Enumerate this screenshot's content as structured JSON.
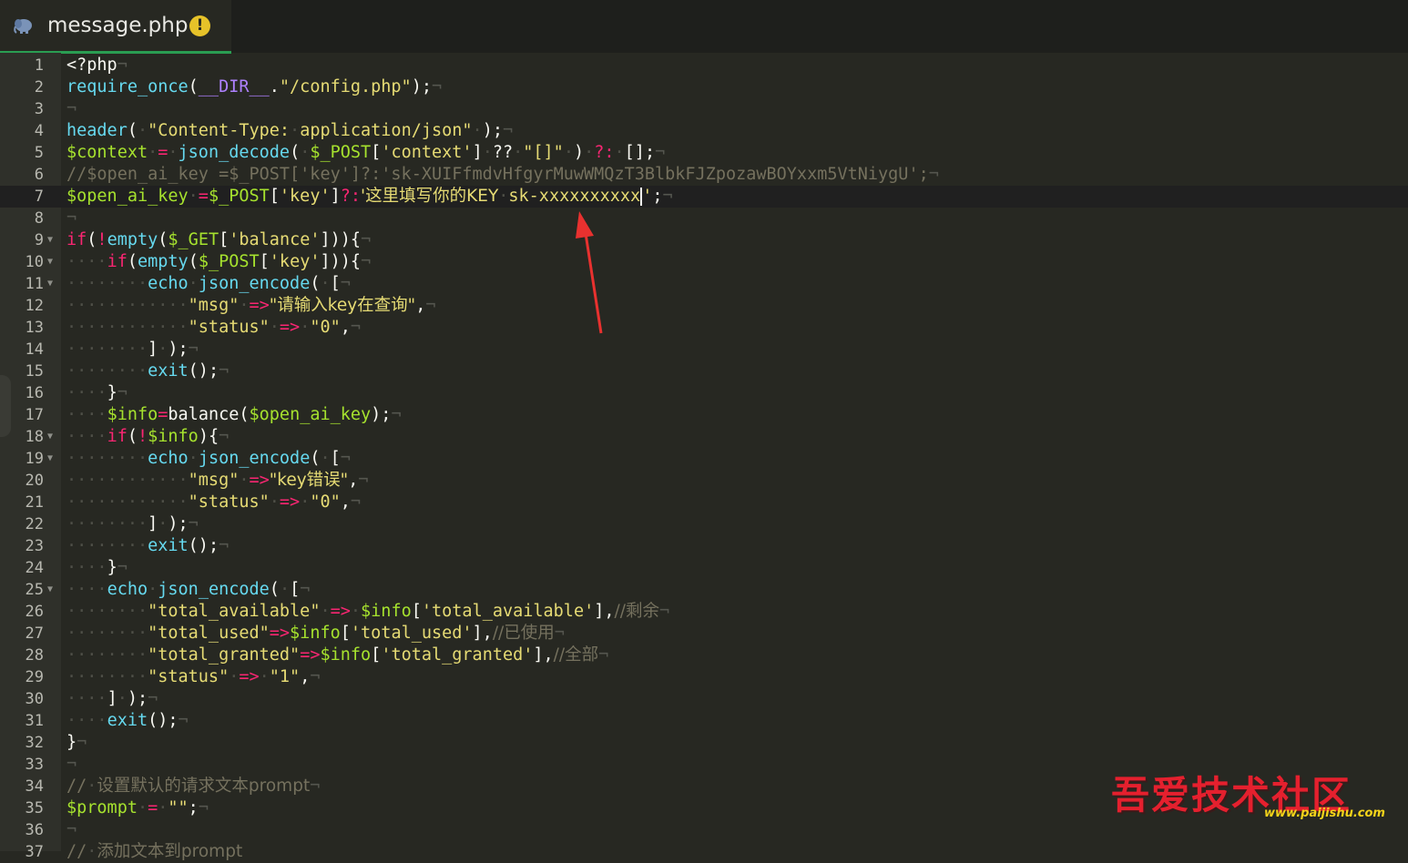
{
  "tab": {
    "filename": "message.php",
    "warning_glyph": "!",
    "file_icon": "php-elephant-icon",
    "active_color": "#2a9d52"
  },
  "active_line": 7,
  "lines": [
    {
      "n": "1",
      "fold": false,
      "tokens": [
        [
          "w",
          "<?php"
        ],
        [
          "e",
          "¬"
        ]
      ]
    },
    {
      "n": "2",
      "fold": false,
      "tokens": [
        [
          "f",
          "require_once"
        ],
        [
          "w",
          "("
        ],
        [
          "p",
          "__DIR__"
        ],
        [
          "w",
          "."
        ],
        [
          "s",
          "\"/config.php\""
        ],
        [
          "w",
          ");"
        ],
        [
          "e",
          "¬"
        ]
      ]
    },
    {
      "n": "3",
      "fold": false,
      "tokens": [
        [
          "e",
          "¬"
        ]
      ]
    },
    {
      "n": "4",
      "fold": false,
      "tokens": [
        [
          "f",
          "header"
        ],
        [
          "w",
          "("
        ],
        [
          "d",
          "·"
        ],
        [
          "s",
          "\"Content-Type:"
        ],
        [
          "d",
          "·"
        ],
        [
          "s",
          "application/json\""
        ],
        [
          "d",
          "·"
        ],
        [
          "w",
          ");"
        ],
        [
          "e",
          "¬"
        ]
      ]
    },
    {
      "n": "5",
      "fold": false,
      "tokens": [
        [
          "v",
          "$context"
        ],
        [
          "d",
          "·"
        ],
        [
          "k",
          "="
        ],
        [
          "d",
          "·"
        ],
        [
          "f",
          "json_decode"
        ],
        [
          "w",
          "("
        ],
        [
          "d",
          "·"
        ],
        [
          "v",
          "$_POST"
        ],
        [
          "w",
          "["
        ],
        [
          "s",
          "'context'"
        ],
        [
          "w",
          "]"
        ],
        [
          "d",
          "·"
        ],
        [
          "w",
          "??"
        ],
        [
          "d",
          "·"
        ],
        [
          "s",
          "\"[]\""
        ],
        [
          "d",
          "·"
        ],
        [
          "w",
          ")"
        ],
        [
          "d",
          "·"
        ],
        [
          "k",
          "?:"
        ],
        [
          "d",
          "·"
        ],
        [
          "w",
          "[];"
        ],
        [
          "e",
          "¬"
        ]
      ]
    },
    {
      "n": "6",
      "fold": false,
      "tokens": [
        [
          "c",
          "//$open_ai_key =$_POST['key']?:'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';"
        ],
        [
          "e",
          "¬"
        ]
      ]
    },
    {
      "n": "7",
      "fold": false,
      "tokens": [
        [
          "v",
          "$open_ai_key"
        ],
        [
          "d",
          "·"
        ],
        [
          "k",
          "="
        ],
        [
          "v",
          "$_POST"
        ],
        [
          "w",
          "["
        ],
        [
          "s",
          "'key'"
        ],
        [
          "w",
          "]"
        ],
        [
          "k",
          "?:"
        ],
        [
          "s",
          "'这里填写你的KEY"
        ],
        [
          "d",
          "·"
        ],
        [
          "s",
          "sk-xxxxxxxxxx"
        ],
        [
          "cursor",
          ""
        ],
        [
          "s",
          "'"
        ],
        [
          "w",
          ";"
        ],
        [
          "e",
          "¬"
        ]
      ]
    },
    {
      "n": "8",
      "fold": false,
      "tokens": [
        [
          "e",
          "¬"
        ]
      ]
    },
    {
      "n": "9",
      "fold": true,
      "tokens": [
        [
          "k",
          "if"
        ],
        [
          "w",
          "("
        ],
        [
          "k",
          "!"
        ],
        [
          "f",
          "empty"
        ],
        [
          "w",
          "("
        ],
        [
          "v",
          "$_GET"
        ],
        [
          "w",
          "["
        ],
        [
          "s",
          "'balance'"
        ],
        [
          "w",
          "])){"
        ],
        [
          "e",
          "¬"
        ]
      ]
    },
    {
      "n": "10",
      "fold": true,
      "tokens": [
        [
          "d",
          "····"
        ],
        [
          "k",
          "if"
        ],
        [
          "w",
          "("
        ],
        [
          "f",
          "empty"
        ],
        [
          "w",
          "("
        ],
        [
          "v",
          "$_POST"
        ],
        [
          "w",
          "["
        ],
        [
          "s",
          "'key'"
        ],
        [
          "w",
          "])){"
        ],
        [
          "e",
          "¬"
        ]
      ]
    },
    {
      "n": "11",
      "fold": true,
      "tokens": [
        [
          "d",
          "········"
        ],
        [
          "f",
          "echo"
        ],
        [
          "d",
          "·"
        ],
        [
          "f",
          "json_encode"
        ],
        [
          "w",
          "("
        ],
        [
          "d",
          "·"
        ],
        [
          "w",
          "["
        ],
        [
          "e",
          "¬"
        ]
      ]
    },
    {
      "n": "12",
      "fold": false,
      "tokens": [
        [
          "d",
          "············"
        ],
        [
          "s",
          "\"msg\""
        ],
        [
          "d",
          "·"
        ],
        [
          "k",
          "=>"
        ],
        [
          "s",
          "\"请输入key在查询\""
        ],
        [
          "w",
          ","
        ],
        [
          "e",
          "¬"
        ]
      ]
    },
    {
      "n": "13",
      "fold": false,
      "tokens": [
        [
          "d",
          "············"
        ],
        [
          "s",
          "\"status\""
        ],
        [
          "d",
          "·"
        ],
        [
          "k",
          "=>"
        ],
        [
          "d",
          "·"
        ],
        [
          "s",
          "\"0\""
        ],
        [
          "w",
          ","
        ],
        [
          "e",
          "¬"
        ]
      ]
    },
    {
      "n": "14",
      "fold": false,
      "tokens": [
        [
          "d",
          "········"
        ],
        [
          "w",
          "]"
        ],
        [
          "d",
          "·"
        ],
        [
          "w",
          ");"
        ],
        [
          "e",
          "¬"
        ]
      ]
    },
    {
      "n": "15",
      "fold": false,
      "tokens": [
        [
          "d",
          "········"
        ],
        [
          "f",
          "exit"
        ],
        [
          "w",
          "();"
        ],
        [
          "e",
          "¬"
        ]
      ]
    },
    {
      "n": "16",
      "fold": false,
      "tokens": [
        [
          "d",
          "····"
        ],
        [
          "w",
          "}"
        ],
        [
          "e",
          "¬"
        ]
      ]
    },
    {
      "n": "17",
      "fold": false,
      "tokens": [
        [
          "d",
          "····"
        ],
        [
          "v",
          "$info"
        ],
        [
          "k",
          "="
        ],
        [
          "w",
          "balance("
        ],
        [
          "v",
          "$open_ai_key"
        ],
        [
          "w",
          ");"
        ],
        [
          "e",
          "¬"
        ]
      ]
    },
    {
      "n": "18",
      "fold": true,
      "tokens": [
        [
          "d",
          "····"
        ],
        [
          "k",
          "if"
        ],
        [
          "w",
          "("
        ],
        [
          "k",
          "!"
        ],
        [
          "v",
          "$info"
        ],
        [
          "w",
          "){"
        ],
        [
          "e",
          "¬"
        ]
      ]
    },
    {
      "n": "19",
      "fold": true,
      "tokens": [
        [
          "d",
          "········"
        ],
        [
          "f",
          "echo"
        ],
        [
          "d",
          "·"
        ],
        [
          "f",
          "json_encode"
        ],
        [
          "w",
          "("
        ],
        [
          "d",
          "·"
        ],
        [
          "w",
          "["
        ],
        [
          "e",
          "¬"
        ]
      ]
    },
    {
      "n": "20",
      "fold": false,
      "tokens": [
        [
          "d",
          "············"
        ],
        [
          "s",
          "\"msg\""
        ],
        [
          "d",
          "·"
        ],
        [
          "k",
          "=>"
        ],
        [
          "s",
          "\"key错误\""
        ],
        [
          "w",
          ","
        ],
        [
          "e",
          "¬"
        ]
      ]
    },
    {
      "n": "21",
      "fold": false,
      "tokens": [
        [
          "d",
          "············"
        ],
        [
          "s",
          "\"status\""
        ],
        [
          "d",
          "·"
        ],
        [
          "k",
          "=>"
        ],
        [
          "d",
          "·"
        ],
        [
          "s",
          "\"0\""
        ],
        [
          "w",
          ","
        ],
        [
          "e",
          "¬"
        ]
      ]
    },
    {
      "n": "22",
      "fold": false,
      "tokens": [
        [
          "d",
          "········"
        ],
        [
          "w",
          "]"
        ],
        [
          "d",
          "·"
        ],
        [
          "w",
          ");"
        ],
        [
          "e",
          "¬"
        ]
      ]
    },
    {
      "n": "23",
      "fold": false,
      "tokens": [
        [
          "d",
          "········"
        ],
        [
          "f",
          "exit"
        ],
        [
          "w",
          "();"
        ],
        [
          "e",
          "¬"
        ]
      ]
    },
    {
      "n": "24",
      "fold": false,
      "tokens": [
        [
          "d",
          "····"
        ],
        [
          "w",
          "}"
        ],
        [
          "e",
          "¬"
        ]
      ]
    },
    {
      "n": "25",
      "fold": true,
      "tokens": [
        [
          "d",
          "····"
        ],
        [
          "f",
          "echo"
        ],
        [
          "d",
          "·"
        ],
        [
          "f",
          "json_encode"
        ],
        [
          "w",
          "("
        ],
        [
          "d",
          "·"
        ],
        [
          "w",
          "["
        ],
        [
          "e",
          "¬"
        ]
      ]
    },
    {
      "n": "26",
      "fold": false,
      "tokens": [
        [
          "d",
          "········"
        ],
        [
          "s",
          "\"total_available\""
        ],
        [
          "d",
          "·"
        ],
        [
          "k",
          "=>"
        ],
        [
          "d",
          "·"
        ],
        [
          "v",
          "$info"
        ],
        [
          "w",
          "["
        ],
        [
          "s",
          "'total_available'"
        ],
        [
          "w",
          "],"
        ],
        [
          "c",
          "//剩余"
        ],
        [
          "e",
          "¬"
        ]
      ]
    },
    {
      "n": "27",
      "fold": false,
      "tokens": [
        [
          "d",
          "········"
        ],
        [
          "s",
          "\"total_used\""
        ],
        [
          "k",
          "=>"
        ],
        [
          "v",
          "$info"
        ],
        [
          "w",
          "["
        ],
        [
          "s",
          "'total_used'"
        ],
        [
          "w",
          "],"
        ],
        [
          "c",
          "//已使用"
        ],
        [
          "e",
          "¬"
        ]
      ]
    },
    {
      "n": "28",
      "fold": false,
      "tokens": [
        [
          "d",
          "········"
        ],
        [
          "s",
          "\"total_granted\""
        ],
        [
          "k",
          "=>"
        ],
        [
          "v",
          "$info"
        ],
        [
          "w",
          "["
        ],
        [
          "s",
          "'total_granted'"
        ],
        [
          "w",
          "],"
        ],
        [
          "c",
          "//全部"
        ],
        [
          "e",
          "¬"
        ]
      ]
    },
    {
      "n": "29",
      "fold": false,
      "tokens": [
        [
          "d",
          "········"
        ],
        [
          "s",
          "\"status\""
        ],
        [
          "d",
          "·"
        ],
        [
          "k",
          "=>"
        ],
        [
          "d",
          "·"
        ],
        [
          "s",
          "\"1\""
        ],
        [
          "w",
          ","
        ],
        [
          "e",
          "¬"
        ]
      ]
    },
    {
      "n": "30",
      "fold": false,
      "tokens": [
        [
          "d",
          "····"
        ],
        [
          "w",
          "]"
        ],
        [
          "d",
          "·"
        ],
        [
          "w",
          ");"
        ],
        [
          "e",
          "¬"
        ]
      ]
    },
    {
      "n": "31",
      "fold": false,
      "tokens": [
        [
          "d",
          "····"
        ],
        [
          "f",
          "exit"
        ],
        [
          "w",
          "();"
        ],
        [
          "e",
          "¬"
        ]
      ]
    },
    {
      "n": "32",
      "fold": false,
      "tokens": [
        [
          "w",
          "}"
        ],
        [
          "e",
          "¬"
        ]
      ]
    },
    {
      "n": "33",
      "fold": false,
      "tokens": [
        [
          "e",
          "¬"
        ]
      ]
    },
    {
      "n": "34",
      "fold": false,
      "tokens": [
        [
          "c",
          "//"
        ],
        [
          "d",
          "·"
        ],
        [
          "c",
          "设置默认的请求文本prompt"
        ],
        [
          "e",
          "¬"
        ]
      ]
    },
    {
      "n": "35",
      "fold": false,
      "tokens": [
        [
          "v",
          "$prompt"
        ],
        [
          "d",
          "·"
        ],
        [
          "k",
          "="
        ],
        [
          "d",
          "·"
        ],
        [
          "s",
          "\"\""
        ],
        [
          "w",
          ";"
        ],
        [
          "e",
          "¬"
        ]
      ]
    },
    {
      "n": "36",
      "fold": false,
      "tokens": [
        [
          "e",
          "¬"
        ]
      ]
    },
    {
      "n": "37",
      "fold": false,
      "tokens": [
        [
          "c",
          "//"
        ],
        [
          "d",
          "·"
        ],
        [
          "c",
          "添加文本到prompt"
        ]
      ]
    }
  ],
  "annotation": {
    "type": "red-arrow",
    "color": "#e8312f"
  },
  "watermark": {
    "text": "吾爱技术社区",
    "url": "www.paijishu.com"
  }
}
